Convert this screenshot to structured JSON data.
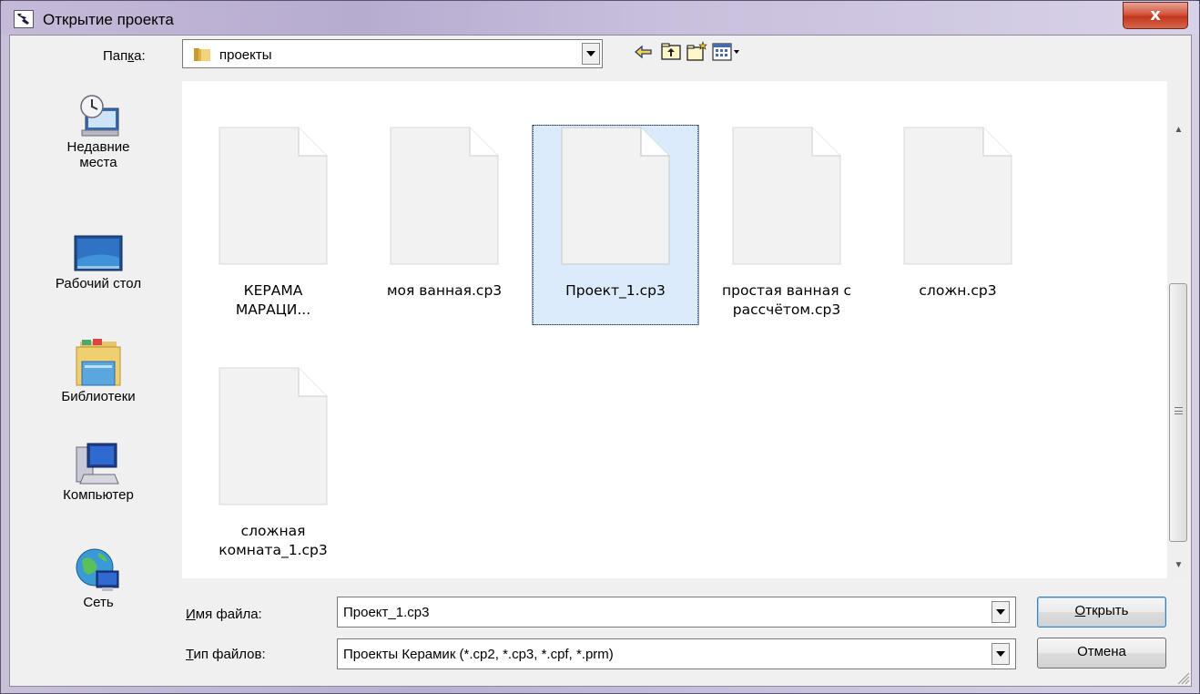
{
  "window": {
    "title": "Открытие проекта",
    "close_label": "x"
  },
  "toolbar": {
    "lookin_label_pre": "Пап",
    "lookin_label_key": "к",
    "lookin_label_post": "а:",
    "lookin_value": "проекты",
    "icons": [
      "back-arrow-icon",
      "up-folder-icon",
      "new-folder-icon",
      "view-menu-icon"
    ]
  },
  "places": [
    {
      "label_line1": "Недавние",
      "label_line2": "места",
      "icon": "recent-places-icon"
    },
    {
      "label_line1": "Рабочий стол",
      "label_line2": "",
      "icon": "desktop-icon"
    },
    {
      "label_line1": "Библиотеки",
      "label_line2": "",
      "icon": "libraries-icon"
    },
    {
      "label_line1": "Компьютер",
      "label_line2": "",
      "icon": "computer-icon"
    },
    {
      "label_line1": "Сеть",
      "label_line2": "",
      "icon": "network-icon"
    }
  ],
  "files": [
    {
      "line1": "КЕРАМА",
      "line2": "МАРАЦИ...",
      "selected": false
    },
    {
      "line1": "моя ванная.cp3",
      "line2": "",
      "selected": false
    },
    {
      "line1": "Проект_1.cp3",
      "line2": "",
      "selected": true
    },
    {
      "line1": "простая ванная с",
      "line2": "рассчётом.cp3",
      "selected": false
    },
    {
      "line1": "сложн.cp3",
      "line2": "",
      "selected": false
    },
    {
      "line1": "сложная",
      "line2": "комната_1.cp3",
      "selected": false
    }
  ],
  "filename": {
    "label_key": "И",
    "label_rest": "мя файла:",
    "value": "Проект_1.cp3"
  },
  "filetype": {
    "label_key": "Т",
    "label_rest": "ип файлов:",
    "value": "Проекты Керамик (*.cp2, *.cp3, *.cpf, *.prm)"
  },
  "buttons": {
    "open_key": "О",
    "open_rest": "ткрыть",
    "cancel": "Отмена"
  },
  "colors": {
    "selection_bg": "#dcebfc",
    "selection_border": "#7da2ce",
    "close_button": "#c2361e"
  }
}
